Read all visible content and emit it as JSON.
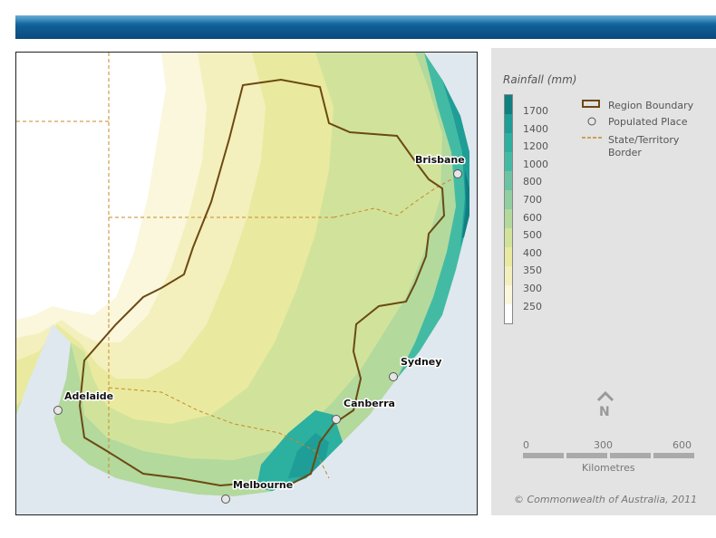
{
  "legend": {
    "title": "Rainfall (mm)",
    "ramp": [
      {
        "label": "1700",
        "color": "#0f7f81"
      },
      {
        "label": "1400",
        "color": "#1f9d97"
      },
      {
        "label": "1200",
        "color": "#2cb0a0"
      },
      {
        "label": "1000",
        "color": "#43bba4"
      },
      {
        "label": "800",
        "color": "#6cc3a3"
      },
      {
        "label": "700",
        "color": "#91cea1"
      },
      {
        "label": "600",
        "color": "#b3d99d"
      },
      {
        "label": "500",
        "color": "#d1e39b"
      },
      {
        "label": "400",
        "color": "#e9ea9f"
      },
      {
        "label": "350",
        "color": "#f4f0bd"
      },
      {
        "label": "300",
        "color": "#faf7dc"
      },
      {
        "label": "250",
        "color": "#ffffff"
      }
    ],
    "symbols": {
      "region_boundary": "Region Boundary",
      "populated_place": "Populated Place",
      "state_border_line1": "State/Territory",
      "state_border_line2": "Border"
    },
    "north_label": "N",
    "scale": {
      "ticks": [
        "0",
        "300",
        "600"
      ],
      "units": "Kilometres"
    },
    "copyright": "© Commonwealth of Australia, 2011"
  },
  "cities": {
    "brisbane": "Brisbane",
    "sydney": "Sydney",
    "canberra": "Canberra",
    "melbourne": "Melbourne",
    "adelaide": "Adelaide"
  },
  "colors": {
    "boundary": "#6b4a12",
    "state_border": "#c8882a",
    "ocean": "#dfe8ee",
    "banner": "#0f5f97"
  }
}
